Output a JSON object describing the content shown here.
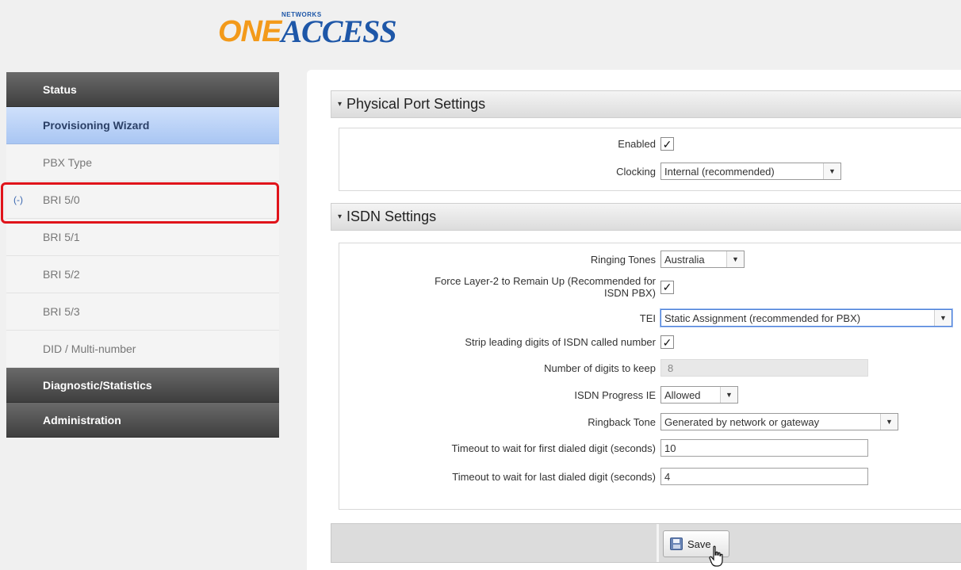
{
  "logo": {
    "part1": "ONE",
    "part2": "ACCESS",
    "networks": "NETWORKS"
  },
  "sidebar": {
    "items": [
      {
        "label": "Status",
        "kind": "section"
      },
      {
        "label": "Provisioning Wizard",
        "kind": "active"
      },
      {
        "label": "PBX Type",
        "kind": "item"
      },
      {
        "label": "BRI 5/0",
        "kind": "item",
        "collapse_marker": "(-)",
        "highlighted": true
      },
      {
        "label": "BRI 5/1",
        "kind": "item"
      },
      {
        "label": "BRI 5/2",
        "kind": "item"
      },
      {
        "label": "BRI 5/3",
        "kind": "item"
      },
      {
        "label": "DID / Multi-number",
        "kind": "item"
      },
      {
        "label": "Diagnostic/Statistics",
        "kind": "section"
      },
      {
        "label": "Administration",
        "kind": "section"
      }
    ]
  },
  "physical": {
    "title": "Physical Port Settings",
    "enabled_label": "Enabled",
    "enabled_checked": true,
    "clocking_label": "Clocking",
    "clocking_value": "Internal (recommended)"
  },
  "isdn": {
    "title": "ISDN Settings",
    "ringing_label": "Ringing Tones",
    "ringing_value": "Australia",
    "force_label_line1": "Force Layer-2 to Remain Up (Recommended for",
    "force_label_line2": "ISDN PBX)",
    "force_checked": true,
    "tei_label": "TEI",
    "tei_value": "Static Assignment (recommended for PBX)",
    "strip_label": "Strip leading digits of ISDN called number",
    "strip_checked": true,
    "digits_label": "Number of digits to keep",
    "digits_value": "8",
    "progress_label": "ISDN Progress IE",
    "progress_value": "Allowed",
    "ringback_label": "Ringback Tone",
    "ringback_value": "Generated by network or gateway",
    "timeout_first_label": "Timeout to wait for first dialed digit (seconds)",
    "timeout_first_value": "10",
    "timeout_last_label": "Timeout to wait for last dialed digit (seconds)",
    "timeout_last_value": "4"
  },
  "footer": {
    "save_label": "Save"
  },
  "icons": {
    "checkmark": "✓",
    "caret": "▼",
    "section_arrow": "▾",
    "save": "floppy-disk-icon",
    "cursor": "hand-pointer-icon"
  }
}
